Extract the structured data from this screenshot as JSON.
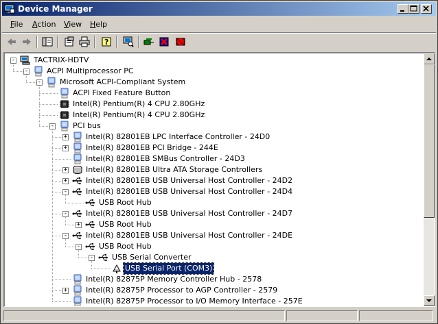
{
  "window": {
    "title": "Device Manager",
    "controls": [
      "minimize",
      "maximize",
      "close"
    ]
  },
  "menu": [
    {
      "label": "File",
      "accel": "F",
      "rest": "ile"
    },
    {
      "label": "Action",
      "accel": "A",
      "rest": "ction"
    },
    {
      "label": "View",
      "accel": "V",
      "rest": "iew"
    },
    {
      "label": "Help",
      "accel": "H",
      "rest": "elp"
    }
  ],
  "toolbar": [
    "back-icon",
    "forward-icon",
    "show-hide-tree-icon",
    "properties-icon",
    "print-icon",
    "help-icon",
    "scan-hardware-icon",
    "update-driver-icon",
    "disable-device-icon",
    "uninstall-device-icon"
  ],
  "tree": [
    {
      "label": "TACTRIX-HDTV",
      "level": 0,
      "exp": "-",
      "icon": "computer-icon"
    },
    {
      "label": "ACPI Multiprocessor PC",
      "level": 1,
      "exp": "-",
      "icon": "pc-icon"
    },
    {
      "label": "Microsoft ACPI-Compliant System",
      "level": 2,
      "exp": "-",
      "icon": "pc-icon"
    },
    {
      "label": "ACPI Fixed Feature Button",
      "level": 3,
      "exp": "",
      "icon": "pc-icon"
    },
    {
      "label": "Intel(R) Pentium(R) 4 CPU 2.80GHz",
      "level": 3,
      "exp": "",
      "icon": "cpu-icon"
    },
    {
      "label": "Intel(R) Pentium(R) 4 CPU 2.80GHz",
      "level": 3,
      "exp": "",
      "icon": "cpu-icon"
    },
    {
      "label": "PCI bus",
      "level": 3,
      "exp": "-",
      "icon": "pc-icon"
    },
    {
      "label": "Intel(R) 82801EB LPC Interface Controller - 24D0",
      "level": 4,
      "exp": "+",
      "icon": "pc-icon"
    },
    {
      "label": "Intel(R) 82801EB PCI Bridge - 244E",
      "level": 4,
      "exp": "+",
      "icon": "pc-icon"
    },
    {
      "label": "Intel(R) 82801EB SMBus Controller - 24D3",
      "level": 4,
      "exp": "",
      "icon": "pc-icon"
    },
    {
      "label": "Intel(R) 82801EB Ultra ATA Storage Controllers",
      "level": 4,
      "exp": "+",
      "icon": "storage-icon"
    },
    {
      "label": "Intel(R) 82801EB USB Universal Host Controller - 24D2",
      "level": 4,
      "exp": "+",
      "icon": "usb-icon"
    },
    {
      "label": "Intel(R) 82801EB USB Universal Host Controller - 24D4",
      "level": 4,
      "exp": "-",
      "icon": "usb-icon"
    },
    {
      "label": "USB Root Hub",
      "level": 5,
      "exp": "",
      "icon": "usb-icon"
    },
    {
      "label": "Intel(R) 82801EB USB Universal Host Controller - 24D7",
      "level": 4,
      "exp": "-",
      "icon": "usb-icon"
    },
    {
      "label": "USB Root Hub",
      "level": 5,
      "exp": "+",
      "icon": "usb-icon"
    },
    {
      "label": "Intel(R) 82801EB USB Universal Host Controller - 24DE",
      "level": 4,
      "exp": "-",
      "icon": "usb-icon"
    },
    {
      "label": "USB Root Hub",
      "level": 5,
      "exp": "-",
      "icon": "usb-icon"
    },
    {
      "label": "USB Serial Converter",
      "level": 6,
      "exp": "-",
      "icon": "usb-icon"
    },
    {
      "label": "USB Serial Port (COM3)",
      "level": 7,
      "exp": "",
      "icon": "port-icon",
      "selected": true
    },
    {
      "label": "Intel(R) 82875P Memory Controller Hub - 2578",
      "level": 4,
      "exp": "",
      "icon": "pc-icon"
    },
    {
      "label": "Intel(R) 82875P Processor to AGP Controller - 2579",
      "level": 4,
      "exp": "+",
      "icon": "pc-icon"
    },
    {
      "label": "Intel(R) 82875P Processor to I/O Memory Interface - 257E",
      "level": 4,
      "exp": "",
      "icon": "pc-icon"
    }
  ]
}
